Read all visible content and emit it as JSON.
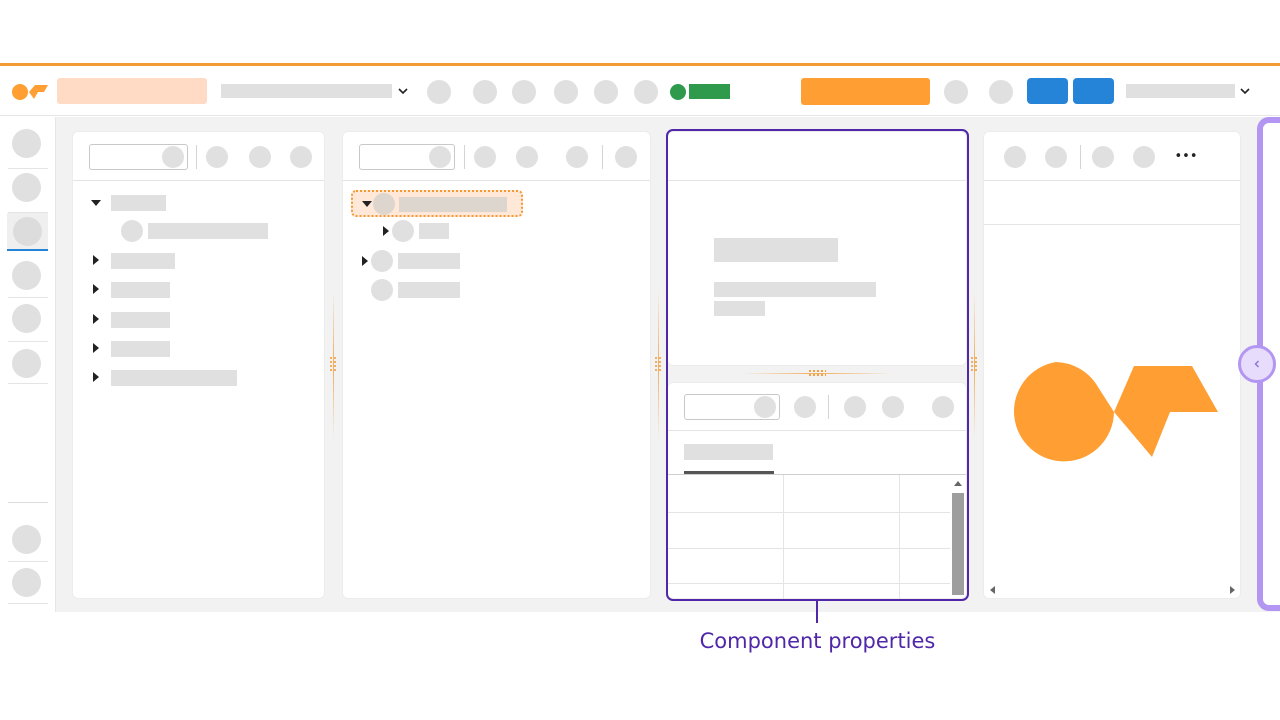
{
  "colors": {
    "accent_orange": "#ff9f33",
    "light_orange": "#ffdac4",
    "status_green": "#2f9a4c",
    "primary_blue": "#2583d8",
    "highlight_purple": "#5027a8",
    "drawer_purple": "#b396f2",
    "placeholder_gray": "#e0e0e0"
  },
  "icons": {
    "logo": "app-logo-icon",
    "dropdown": "chevron-down-icon",
    "more": "more-horizontal-icon",
    "collapse": "chevron-left-icon"
  },
  "toolbar": {
    "more_label": "•••"
  },
  "callout": {
    "label": "Component properties"
  }
}
